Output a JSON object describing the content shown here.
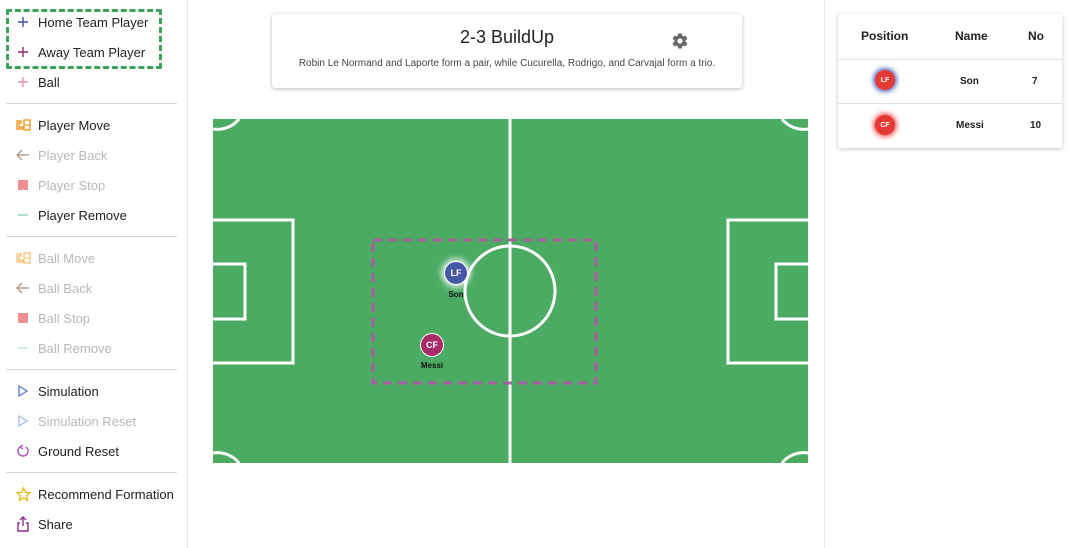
{
  "sidebar": {
    "items": [
      {
        "label": "Home Team Player",
        "icon": "plus-icon",
        "disabled": false
      },
      {
        "label": "Away Team Player",
        "icon": "plus-icon",
        "disabled": false
      },
      {
        "label": "Ball",
        "icon": "plus-icon",
        "disabled": false
      },
      {
        "label": "Player Move",
        "icon": "move-icon",
        "disabled": false
      },
      {
        "label": "Player Back",
        "icon": "arrow-left-icon",
        "disabled": true
      },
      {
        "label": "Player Stop",
        "icon": "stop-icon",
        "disabled": true
      },
      {
        "label": "Player Remove",
        "icon": "minus-icon",
        "disabled": false
      },
      {
        "label": "Ball Move",
        "icon": "move-icon",
        "disabled": true
      },
      {
        "label": "Ball Back",
        "icon": "arrow-left-icon",
        "disabled": true
      },
      {
        "label": "Ball Stop",
        "icon": "stop-icon",
        "disabled": true
      },
      {
        "label": "Ball Remove",
        "icon": "minus-icon",
        "disabled": true
      },
      {
        "label": "Simulation",
        "icon": "play-icon",
        "disabled": false
      },
      {
        "label": "Simulation Reset",
        "icon": "play-icon",
        "disabled": true
      },
      {
        "label": "Ground Reset",
        "icon": "reset-icon",
        "disabled": false
      },
      {
        "label": "Recommend Formation",
        "icon": "star-icon",
        "disabled": false
      },
      {
        "label": "Share",
        "icon": "share-icon",
        "disabled": false
      }
    ]
  },
  "formation": {
    "title": "2-3 BuildUp",
    "description": "Robin Le Normand and Laporte form a pair, while Cucurella, Rodrigo, and Carvajal form a trio."
  },
  "pitch_players": [
    {
      "position": "LF",
      "name": "Son",
      "team": "home"
    },
    {
      "position": "CF",
      "name": "Messi",
      "team": "away"
    }
  ],
  "roster": {
    "headers": {
      "position": "Position",
      "name": "Name",
      "no": "No"
    },
    "rows": [
      {
        "position": "LF",
        "name": "Son",
        "no": "7"
      },
      {
        "position": "CF",
        "name": "Messi",
        "no": "10"
      }
    ]
  },
  "colors": {
    "pitch": "#4bab63",
    "home_player": "#4558a8",
    "away_player": "#a52c68",
    "badge_red": "#e53935",
    "highlight": "#3aa35a",
    "zone_dash": "#a95ea0"
  }
}
